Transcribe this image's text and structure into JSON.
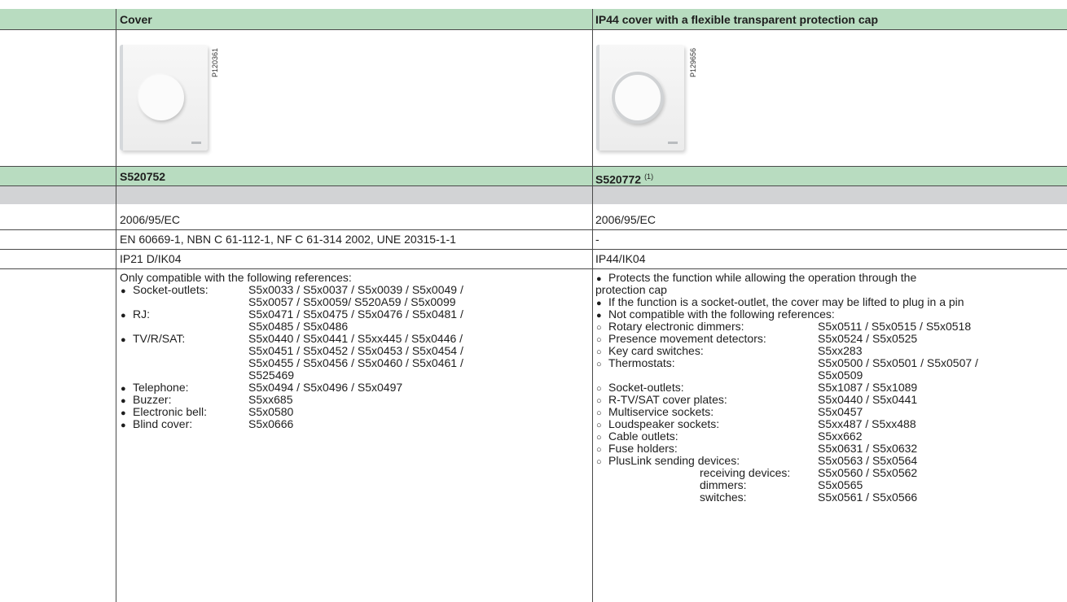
{
  "header": {
    "col1_title": "Cover",
    "col2_title": "IP44 cover with a flexible transparent protection cap"
  },
  "photos": {
    "col1_ref": "P120361",
    "col2_ref": "P129656"
  },
  "references": {
    "col1": "S520752",
    "col2": "S520772",
    "col2_note": "(1)"
  },
  "rows": {
    "directive": {
      "col1": "2006/95/EC",
      "col2": "2006/95/EC"
    },
    "standards": {
      "col1": "EN 60669-1, NBN C 61-112-1, NF C 61-314 2002, UNE 20315-1-1",
      "col2": "-"
    },
    "protection": {
      "col1": "IP21 D/IK04",
      "col2": "IP44/IK04"
    }
  },
  "compat_left": {
    "intro": "Only compatible with the following references:",
    "lines": [
      {
        "bullet": "dot",
        "label": "Socket-outlets:",
        "value": "S5x0033 / S5x0037 / S5x0039 / S5x0049 /"
      },
      {
        "bullet": "",
        "label": "",
        "value": "S5x0057 / S5x0059/ S520A59 / S5x0099"
      },
      {
        "bullet": "dot",
        "label": "RJ:",
        "value": "S5x0471 / S5x0475 / S5x0476 / S5x0481 /"
      },
      {
        "bullet": "",
        "label": "",
        "value": "S5x0485 / S5x0486"
      },
      {
        "bullet": "dot",
        "label": "TV/R/SAT:",
        "value": "S5x0440 / S5x0441 / S5xx445 / S5x0446 /"
      },
      {
        "bullet": "",
        "label": "",
        "value": "S5x0451 / S5x0452 / S5x0453 / S5x0454 /"
      },
      {
        "bullet": "",
        "label": "",
        "value": "S5x0455 / S5x0456 / S5x0460 / S5x0461 /"
      },
      {
        "bullet": "",
        "label": "",
        "value": "S525469"
      },
      {
        "bullet": "dot",
        "label": "Telephone:",
        "value": "S5x0494 / S5x0496 / S5x0497"
      },
      {
        "bullet": "dot",
        "label": "Buzzer:",
        "value": "S5xx685"
      },
      {
        "bullet": "dot",
        "label": "Electronic bell:",
        "value": "S5x0580"
      },
      {
        "bullet": "dot",
        "label": "Blind cover:",
        "value": "S5x0666"
      }
    ]
  },
  "compat_right": {
    "lines": [
      {
        "bullet": "dot",
        "label": "Protects the function while allowing the operation through the",
        "value": "",
        "indent": 0
      },
      {
        "bullet": "",
        "label": "protection cap",
        "value": "",
        "indent": -1
      },
      {
        "bullet": "dot",
        "label": "If the function is a socket-outlet, the cover may be lifted to plug in a pin",
        "value": "",
        "indent": 0
      },
      {
        "bullet": "dot",
        "label": "Not compatible with the following references:",
        "value": "",
        "indent": 0
      },
      {
        "bullet": "circ",
        "label": "Rotary electronic dimmers:",
        "value": "S5x0511 / S5x0515 / S5x0518",
        "indent": 0
      },
      {
        "bullet": "circ",
        "label": "Presence movement detectors:",
        "value": "S5x0524 / S5x0525",
        "indent": 0,
        "tight": true
      },
      {
        "bullet": "circ",
        "label": "Key card switches:",
        "value": "S5xx283",
        "indent": 0
      },
      {
        "bullet": "circ",
        "label": "Thermostats:",
        "value": "S5x0500 / S5x0501 / S5x0507 /",
        "indent": 0
      },
      {
        "bullet": "",
        "label": "",
        "value": "S5x0509",
        "indent": 0
      },
      {
        "bullet": "circ",
        "label": "Socket-outlets:",
        "value": "S5x1087 / S5x1089",
        "indent": 0
      },
      {
        "bullet": "circ",
        "label": "R-TV/SAT cover plates:",
        "value": "S5x0440 / S5x0441",
        "indent": 0
      },
      {
        "bullet": "circ",
        "label": "Multiservice sockets:",
        "value": "S5x0457",
        "indent": 0
      },
      {
        "bullet": "circ",
        "label": "Loudspeaker sockets:",
        "value": "S5xx487 / S5xx488",
        "indent": 0
      },
      {
        "bullet": "circ",
        "label": "Cable outlets:",
        "value": "S5xx662",
        "indent": 0
      },
      {
        "bullet": "circ",
        "label": "Fuse holders:",
        "value": "S5x0631 / S5x0632",
        "indent": 0
      },
      {
        "bullet": "circ",
        "label": "PlusLink sending devices:",
        "value": "S5x0563 / S5x0564",
        "indent": 0
      },
      {
        "bullet": "",
        "label": "receiving devices:",
        "value": "S5x0560 / S5x0562",
        "indent": 1
      },
      {
        "bullet": "",
        "label": "dimmers:",
        "value": "S5x0565",
        "indent": 1
      },
      {
        "bullet": "",
        "label": "switches:",
        "value": "S5x0561 / S5x0566",
        "indent": 1
      }
    ]
  }
}
